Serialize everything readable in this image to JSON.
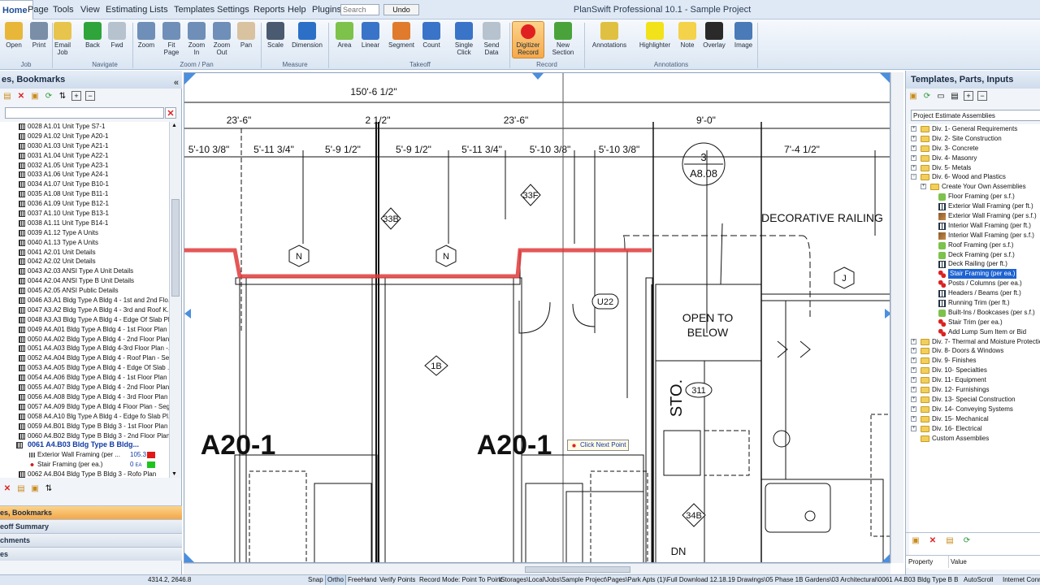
{
  "app": {
    "title": "PlanSwift Professional 10.1 - Sample Project"
  },
  "menu": [
    "Home",
    "Page",
    "Tools",
    "View",
    "Estimating",
    "Lists",
    "Templates",
    "Settings",
    "Reports",
    "Help",
    "Plugins"
  ],
  "search": {
    "placeholder": "Search"
  },
  "undo_label": "Undo",
  "ribbon": {
    "tools": [
      {
        "id": "open",
        "label": "Open",
        "icon": "folder-icon",
        "color": "#e8b73a"
      },
      {
        "id": "print",
        "label": "Print",
        "icon": "printer-icon",
        "color": "#7a8ea8"
      },
      {
        "id": "email",
        "label": "Email\nJob",
        "icon": "envelope-icon",
        "color": "#e7c44c"
      },
      {
        "id": "back",
        "label": "Back",
        "icon": "back-arrow-icon",
        "color": "#2ea43a"
      },
      {
        "id": "fwd",
        "label": "Fwd",
        "icon": "forward-arrow-icon",
        "color": "#b7c2cf"
      },
      {
        "id": "zoom",
        "label": "Zoom",
        "icon": "magnifier-icon",
        "color": "#6f8fb8"
      },
      {
        "id": "fitpage",
        "label": "Fit\nPage",
        "icon": "fit-page-icon",
        "color": "#6f8fb8"
      },
      {
        "id": "zoomin",
        "label": "Zoom\nIn",
        "icon": "zoom-in-icon",
        "color": "#6f8fb8"
      },
      {
        "id": "zoomout",
        "label": "Zoom\nOut",
        "icon": "zoom-out-icon",
        "color": "#6f8fb8"
      },
      {
        "id": "pan",
        "label": "Pan",
        "icon": "hand-icon",
        "color": "#d9c2a0"
      },
      {
        "id": "scale",
        "label": "Scale",
        "icon": "scale-icon",
        "color": "#4a5a70"
      },
      {
        "id": "dimension",
        "label": "Dimension",
        "icon": "ruler-icon",
        "color": "#2c6fc7"
      },
      {
        "id": "area",
        "label": "Area",
        "icon": "area-icon",
        "color": "#7cc24b"
      },
      {
        "id": "linear",
        "label": "Linear",
        "icon": "linear-icon",
        "color": "#3a74c8"
      },
      {
        "id": "segment",
        "label": "Segment",
        "icon": "segment-icon",
        "color": "#e07a2c"
      },
      {
        "id": "count",
        "label": "Count",
        "icon": "count-icon",
        "color": "#3a74c8"
      },
      {
        "id": "singleclick",
        "label": "Single\nClick",
        "icon": "single-click-icon",
        "color": "#3a74c8"
      },
      {
        "id": "senddata",
        "label": "Send\nData",
        "icon": "send-data-icon",
        "color": "#b7c2cf"
      },
      {
        "id": "digitizer",
        "label": "Digitizer\nRecord",
        "icon": "record-icon",
        "color": "#e02020"
      },
      {
        "id": "newsection",
        "label": "New\nSection",
        "icon": "new-section-icon",
        "color": "#4aa33a"
      },
      {
        "id": "annotations",
        "label": "Annotations",
        "icon": "pencil-icon",
        "color": "#e0c040"
      },
      {
        "id": "highlighter",
        "label": "Highlighter",
        "icon": "highlighter-icon",
        "color": "#f2e21a"
      },
      {
        "id": "note",
        "label": "Note",
        "icon": "note-icon",
        "color": "#f4d24a"
      },
      {
        "id": "overlay",
        "label": "Overlay",
        "icon": "overlay-icon",
        "color": "#2a2a2a"
      },
      {
        "id": "image",
        "label": "Image",
        "icon": "image-icon",
        "color": "#4a7ab8"
      }
    ],
    "groups": [
      "Job",
      "Navigate",
      "Zoom / Pan",
      "Measure",
      "Takeoff",
      "Record",
      "Annotations"
    ]
  },
  "left_panel": {
    "title": "es, Bookmarks",
    "pages": [
      "0028 A1.01 Unit Type S7-1",
      "0029 A1.02 Unit Type A20-1",
      "0030 A1.03 Unit Type A21-1",
      "0031 A1.04 Unit Type A22-1",
      "0032 A1.05 Unit Type A23-1",
      "0033 A1.06 Unit Type A24-1",
      "0034 A1.07 Unit Type B10-1",
      "0035 A1.08 Unit Type B11-1",
      "0036 A1.09 Unit Type B12-1",
      "0037 A1.10 Unit Type B13-1",
      "0038 A1.11 Unit Type B14-1",
      "0039 A1.12 Type A Units",
      "0040 A1.13 Type A Units",
      "0041 A2.01 Unit Details",
      "0042 A2.02 Unit Details",
      "0043 A2.03 ANSI Type A Unit Details",
      "0044 A2.04 ANSI Type B Unit Details",
      "0045 A2.05 ANSI Public Details",
      "0046 A3.A1 Bldg Type A Bldg 4 - 1st and 2nd Flo...",
      "0047 A3.A2 Bldg Type A Bldg 4 - 3rd and Roof K...",
      "0048 A3.A3 Bldg Type A Bldg 4 - Edge Of Slab Plan",
      "0049 A4.A01 Bldg Type A Bldg 4 - 1st Floor Plan ...",
      "0050 A4.A02 Bldg Type A Bldg 4 - 2nd Floor Plan ...",
      "0051 A4.A03 Bldg Type A Bldg 4-3rd Floor Plan -...",
      "0052 A4.A04 Bldg Type A Bldg 4 - Roof Plan - Se...",
      "0053 A4.A05 Bldg Type A Bldg 4 - Edge Of Slab ...",
      "0054 A4.A06 Bldg Type A Bldg 4 - 1st Floor Plan ...",
      "0055 A4.A07 Bldg Type A Bldg 4 - 2nd Floor Plan ...",
      "0056 A4.A08 Bldg Type A Bldg 4 - 3rd Floor Plan ...",
      "0057 A4.A09 Bldg Type A Bldg 4 Floor Plan - Seg...",
      "0058 A4.A10 Blg Type A Bldg 4 - Edge fo Slab Pl...",
      "0059 A4.B01 Bldg Type B Bldg 3 - 1st Floor Plan",
      "0060 A4.B02 Bldg Type B Bldg 3 - 2nd Floor Plan"
    ],
    "selected_page": "0061 A4.B03 Bldg Type B Bldg...",
    "children": [
      {
        "label": "Exterior Wall Framing (per ...",
        "qty": "105.3",
        "unit": "FT",
        "color": "#e01818"
      },
      {
        "label": "Stair Framing (per ea.)",
        "qty": "0",
        "unit": "EA",
        "color": "#1ec41e"
      }
    ],
    "after_page": "0062 A4.B04 Bldg Type B Bldg 3 - Rofo Plan",
    "stack": [
      "es, Bookmarks",
      "eoff Summary",
      "chments",
      "es"
    ]
  },
  "drawing": {
    "dims_top": "150'-6 1/2\"",
    "dims_row2": [
      "23'-6\"",
      "2 1/2\"",
      "23'-6\"",
      "9'-0\""
    ],
    "dims_row3": [
      "5'-10 3/8\"",
      "5'-11 3/4\"",
      "5'-9 1/2\"",
      "5'-9 1/2\"",
      "5'-11 3/4\"",
      "5'-10 3/8\"",
      "5'-10 3/8\"",
      "7'-4 1/2\""
    ],
    "tags": [
      "33B",
      "33F",
      "N",
      "N",
      "1B",
      "J",
      "U22",
      "311",
      "34B"
    ],
    "detail_num": "3",
    "detail_sheet": "A8.08",
    "room_labels": [
      "DECORATIVE RAILING",
      "OPEN TO",
      "BELOW",
      "STO.",
      "DN"
    ],
    "unit_labels": [
      "A20-1",
      "A20-1"
    ],
    "tooltip": "Click Next Point"
  },
  "right_panel": {
    "title": "Templates, Parts, Inputs",
    "select_value": "Project Estimate Assemblies",
    "tree": [
      {
        "label": "Div. 1- General Requirements",
        "level": 0,
        "kind": "folder"
      },
      {
        "label": "Div. 2- Site Construction",
        "level": 0,
        "kind": "folder"
      },
      {
        "label": "Div. 3- Concrete",
        "level": 0,
        "kind": "folder"
      },
      {
        "label": "Div. 4- Masonry",
        "level": 0,
        "kind": "folder"
      },
      {
        "label": "Div. 5- Metals",
        "level": 0,
        "kind": "folder"
      },
      {
        "label": "Div. 6- Wood and Plastics",
        "level": 0,
        "kind": "folder",
        "open": true
      },
      {
        "label": "Create Your Own Assemblies",
        "level": 1,
        "kind": "folder"
      },
      {
        "label": "Floor Framing (per s.f.)",
        "level": 1,
        "kind": "area"
      },
      {
        "label": "Exterior Wall Framing (per ft.)",
        "level": 1,
        "kind": "linear"
      },
      {
        "label": "Exterior Wall Framing (per s.f.)",
        "level": 1,
        "kind": "wall"
      },
      {
        "label": "Interior Wall Framing (per ft.)",
        "level": 1,
        "kind": "linear"
      },
      {
        "label": "Interior Wall Framing (per s.f.)",
        "level": 1,
        "kind": "wall"
      },
      {
        "label": "Roof Framing (per s.f.)",
        "level": 1,
        "kind": "area"
      },
      {
        "label": "Deck Framing (per s.f.)",
        "level": 1,
        "kind": "area"
      },
      {
        "label": "Deck Railing (per ft.)",
        "level": 1,
        "kind": "linear"
      },
      {
        "label": "Stair Framing (per ea.)",
        "level": 1,
        "kind": "count",
        "selected": true
      },
      {
        "label": "Posts / Columns (per ea.)",
        "level": 1,
        "kind": "count"
      },
      {
        "label": "Headers / Beams (per ft.)",
        "level": 1,
        "kind": "linear"
      },
      {
        "label": "Running Trim (per ft.)",
        "level": 1,
        "kind": "linear"
      },
      {
        "label": "Built-Ins / Bookcases (per s.f.)",
        "level": 1,
        "kind": "area"
      },
      {
        "label": "Stair Trim (per ea.)",
        "level": 1,
        "kind": "count"
      },
      {
        "label": "Add Lump Sum Item or Bid",
        "level": 1,
        "kind": "count"
      },
      {
        "label": "Div. 7- Thermal and Moisture Protection",
        "level": 0,
        "kind": "folder"
      },
      {
        "label": "Div. 8- Doors & Windows",
        "level": 0,
        "kind": "folder"
      },
      {
        "label": "Div. 9- Finishes",
        "level": 0,
        "kind": "folder"
      },
      {
        "label": "Div. 10- Specialties",
        "level": 0,
        "kind": "folder"
      },
      {
        "label": "Div. 11- Equipment",
        "level": 0,
        "kind": "folder"
      },
      {
        "label": "Div. 12- Furnishings",
        "level": 0,
        "kind": "folder"
      },
      {
        "label": "Div. 13- Special Construction",
        "level": 0,
        "kind": "folder"
      },
      {
        "label": "Div. 14- Conveying Systems",
        "level": 0,
        "kind": "folder"
      },
      {
        "label": "Div. 15- Mechanical",
        "level": 0,
        "kind": "folder"
      },
      {
        "label": "Div. 16- Electrical",
        "level": 0,
        "kind": "folder"
      },
      {
        "label": "Custom Assemblies",
        "level": 0,
        "kind": "folder",
        "noexp": true
      }
    ],
    "prop_header": "Property",
    "value_header": "Value"
  },
  "status": {
    "coords": "4314.2, 2646.8",
    "snap": "Snap",
    "ortho": "Ortho",
    "freehand": "FreeHand",
    "verify": "Verify Points",
    "record_mode": "Record Mode: Point To Point",
    "path": "\\Storages\\Local\\Jobs\\Sample Project\\Pages\\Park Apts (1)\\Full Download 12.18.19 Drawings\\05 Phase 1B Gardens\\03 Architectural\\0061 A4.B03 Bldg Type B Bldg 3 -",
    "autoscroll": "AutoScroll",
    "internet": "Internet Conn"
  }
}
